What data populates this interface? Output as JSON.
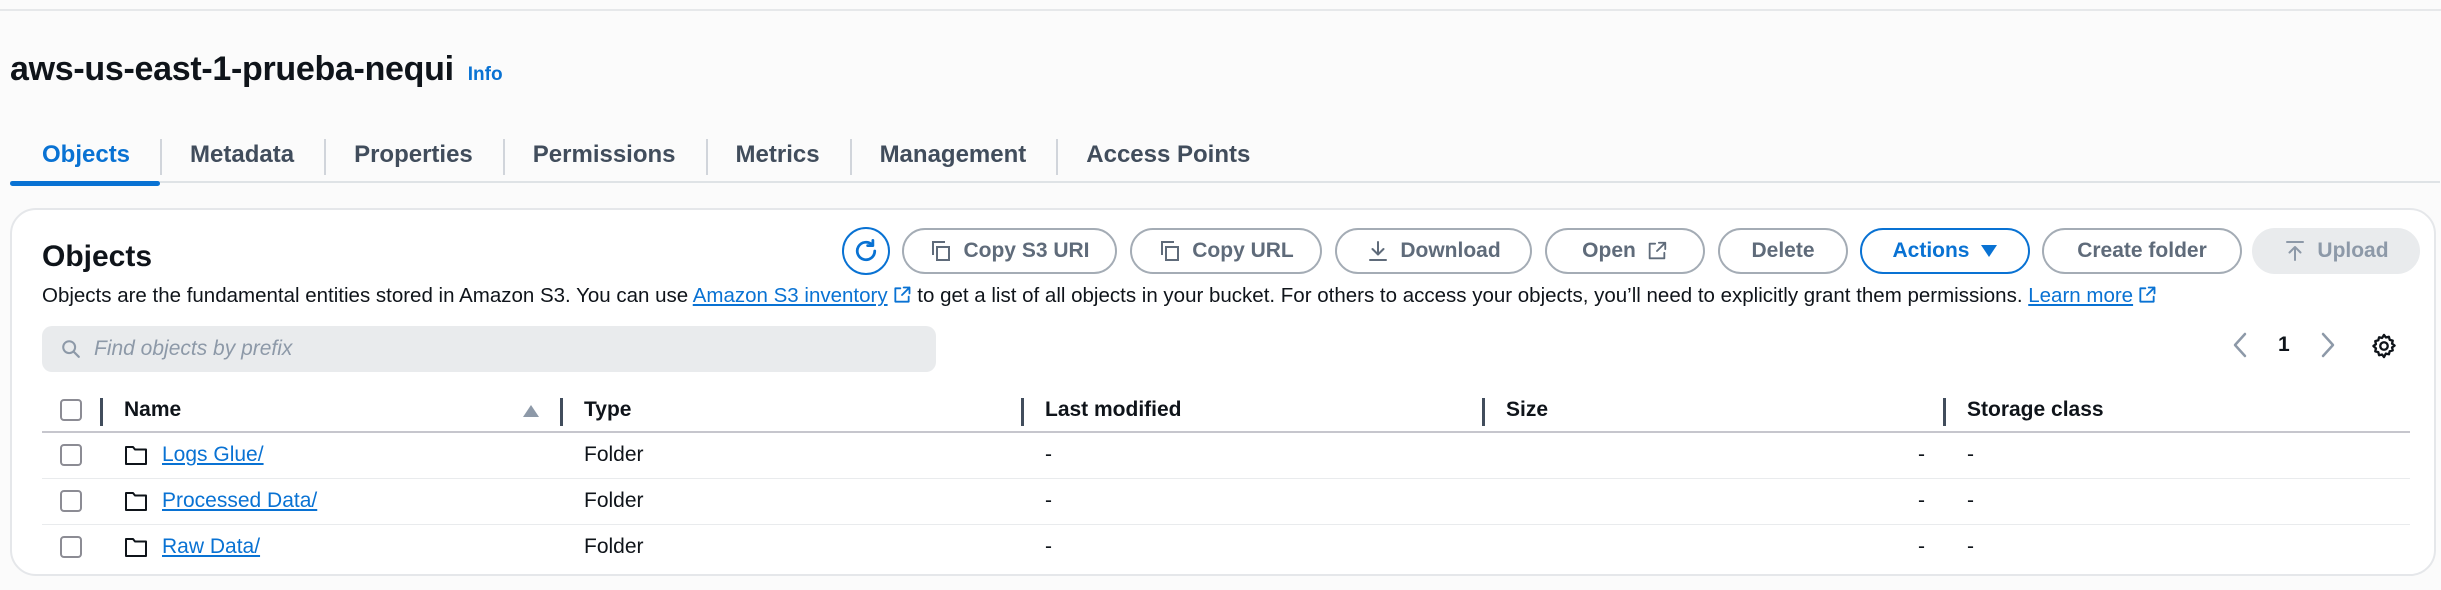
{
  "bucket": {
    "name": "aws-us-east-1-prueba-nequi",
    "info_label": "Info"
  },
  "tabs": [
    {
      "label": "Objects",
      "active": true
    },
    {
      "label": "Metadata"
    },
    {
      "label": "Properties"
    },
    {
      "label": "Permissions"
    },
    {
      "label": "Metrics"
    },
    {
      "label": "Management"
    },
    {
      "label": "Access Points"
    }
  ],
  "panel": {
    "title": "Objects",
    "toolbar": {
      "refresh_icon": "refresh-icon",
      "copy_s3_uri": "Copy S3 URI",
      "copy_url": "Copy URL",
      "download": "Download",
      "open": "Open",
      "delete": "Delete",
      "actions": "Actions",
      "create_folder": "Create folder",
      "upload": "Upload"
    },
    "description": {
      "part1": "Objects are the fundamental entities stored in Amazon S3. You can use ",
      "link1": "Amazon S3 inventory",
      "part2": " to get a list of all objects in your bucket. For others to access your objects, you’ll need to explicitly grant them permissions. ",
      "link2": "Learn more"
    },
    "search": {
      "placeholder": "Find objects by prefix",
      "value": ""
    },
    "pagination": {
      "current_page": "1"
    },
    "table": {
      "columns": [
        "Name",
        "Type",
        "Last modified",
        "Size",
        "Storage class"
      ],
      "rows": [
        {
          "name": "Logs Glue/",
          "type": "Folder",
          "last_modified": "-",
          "size": "-",
          "storage_class": "-"
        },
        {
          "name": "Processed Data/",
          "type": "Folder",
          "last_modified": "-",
          "size": "-",
          "storage_class": "-"
        },
        {
          "name": "Raw Data/",
          "type": "Folder",
          "last_modified": "-",
          "size": "-",
          "storage_class": "-"
        }
      ]
    }
  },
  "colors": {
    "accent": "#0972d3",
    "text": "#0f141a",
    "muted": "#5f6b7a",
    "disabled_bg": "#e9ebed"
  }
}
